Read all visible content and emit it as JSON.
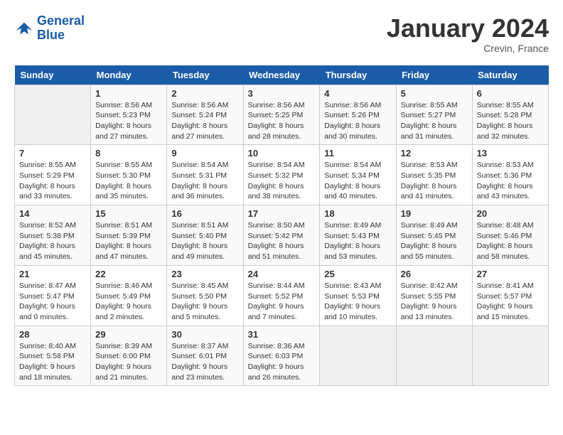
{
  "logo": {
    "line1": "General",
    "line2": "Blue"
  },
  "title": "January 2024",
  "subtitle": "Crevin, France",
  "days_header": [
    "Sunday",
    "Monday",
    "Tuesday",
    "Wednesday",
    "Thursday",
    "Friday",
    "Saturday"
  ],
  "weeks": [
    [
      {
        "num": "",
        "info": ""
      },
      {
        "num": "1",
        "info": "Sunrise: 8:56 AM\nSunset: 5:23 PM\nDaylight: 8 hours\nand 27 minutes."
      },
      {
        "num": "2",
        "info": "Sunrise: 8:56 AM\nSunset: 5:24 PM\nDaylight: 8 hours\nand 27 minutes."
      },
      {
        "num": "3",
        "info": "Sunrise: 8:56 AM\nSunset: 5:25 PM\nDaylight: 8 hours\nand 28 minutes."
      },
      {
        "num": "4",
        "info": "Sunrise: 8:56 AM\nSunset: 5:26 PM\nDaylight: 8 hours\nand 30 minutes."
      },
      {
        "num": "5",
        "info": "Sunrise: 8:55 AM\nSunset: 5:27 PM\nDaylight: 8 hours\nand 31 minutes."
      },
      {
        "num": "6",
        "info": "Sunrise: 8:55 AM\nSunset: 5:28 PM\nDaylight: 8 hours\nand 32 minutes."
      }
    ],
    [
      {
        "num": "7",
        "info": "Sunrise: 8:55 AM\nSunset: 5:29 PM\nDaylight: 8 hours\nand 33 minutes."
      },
      {
        "num": "8",
        "info": "Sunrise: 8:55 AM\nSunset: 5:30 PM\nDaylight: 8 hours\nand 35 minutes."
      },
      {
        "num": "9",
        "info": "Sunrise: 8:54 AM\nSunset: 5:31 PM\nDaylight: 8 hours\nand 36 minutes."
      },
      {
        "num": "10",
        "info": "Sunrise: 8:54 AM\nSunset: 5:32 PM\nDaylight: 8 hours\nand 38 minutes."
      },
      {
        "num": "11",
        "info": "Sunrise: 8:54 AM\nSunset: 5:34 PM\nDaylight: 8 hours\nand 40 minutes."
      },
      {
        "num": "12",
        "info": "Sunrise: 8:53 AM\nSunset: 5:35 PM\nDaylight: 8 hours\nand 41 minutes."
      },
      {
        "num": "13",
        "info": "Sunrise: 8:53 AM\nSunset: 5:36 PM\nDaylight: 8 hours\nand 43 minutes."
      }
    ],
    [
      {
        "num": "14",
        "info": "Sunrise: 8:52 AM\nSunset: 5:38 PM\nDaylight: 8 hours\nand 45 minutes."
      },
      {
        "num": "15",
        "info": "Sunrise: 8:51 AM\nSunset: 5:39 PM\nDaylight: 8 hours\nand 47 minutes."
      },
      {
        "num": "16",
        "info": "Sunrise: 8:51 AM\nSunset: 5:40 PM\nDaylight: 8 hours\nand 49 minutes."
      },
      {
        "num": "17",
        "info": "Sunrise: 8:50 AM\nSunset: 5:42 PM\nDaylight: 8 hours\nand 51 minutes."
      },
      {
        "num": "18",
        "info": "Sunrise: 8:49 AM\nSunset: 5:43 PM\nDaylight: 8 hours\nand 53 minutes."
      },
      {
        "num": "19",
        "info": "Sunrise: 8:49 AM\nSunset: 5:45 PM\nDaylight: 8 hours\nand 55 minutes."
      },
      {
        "num": "20",
        "info": "Sunrise: 8:48 AM\nSunset: 5:46 PM\nDaylight: 8 hours\nand 58 minutes."
      }
    ],
    [
      {
        "num": "21",
        "info": "Sunrise: 8:47 AM\nSunset: 5:47 PM\nDaylight: 9 hours\nand 0 minutes."
      },
      {
        "num": "22",
        "info": "Sunrise: 8:46 AM\nSunset: 5:49 PM\nDaylight: 9 hours\nand 2 minutes."
      },
      {
        "num": "23",
        "info": "Sunrise: 8:45 AM\nSunset: 5:50 PM\nDaylight: 9 hours\nand 5 minutes."
      },
      {
        "num": "24",
        "info": "Sunrise: 8:44 AM\nSunset: 5:52 PM\nDaylight: 9 hours\nand 7 minutes."
      },
      {
        "num": "25",
        "info": "Sunrise: 8:43 AM\nSunset: 5:53 PM\nDaylight: 9 hours\nand 10 minutes."
      },
      {
        "num": "26",
        "info": "Sunrise: 8:42 AM\nSunset: 5:55 PM\nDaylight: 9 hours\nand 13 minutes."
      },
      {
        "num": "27",
        "info": "Sunrise: 8:41 AM\nSunset: 5:57 PM\nDaylight: 9 hours\nand 15 minutes."
      }
    ],
    [
      {
        "num": "28",
        "info": "Sunrise: 8:40 AM\nSunset: 5:58 PM\nDaylight: 9 hours\nand 18 minutes."
      },
      {
        "num": "29",
        "info": "Sunrise: 8:39 AM\nSunset: 6:00 PM\nDaylight: 9 hours\nand 21 minutes."
      },
      {
        "num": "30",
        "info": "Sunrise: 8:37 AM\nSunset: 6:01 PM\nDaylight: 9 hours\nand 23 minutes."
      },
      {
        "num": "31",
        "info": "Sunrise: 8:36 AM\nSunset: 6:03 PM\nDaylight: 9 hours\nand 26 minutes."
      },
      {
        "num": "",
        "info": ""
      },
      {
        "num": "",
        "info": ""
      },
      {
        "num": "",
        "info": ""
      }
    ]
  ]
}
